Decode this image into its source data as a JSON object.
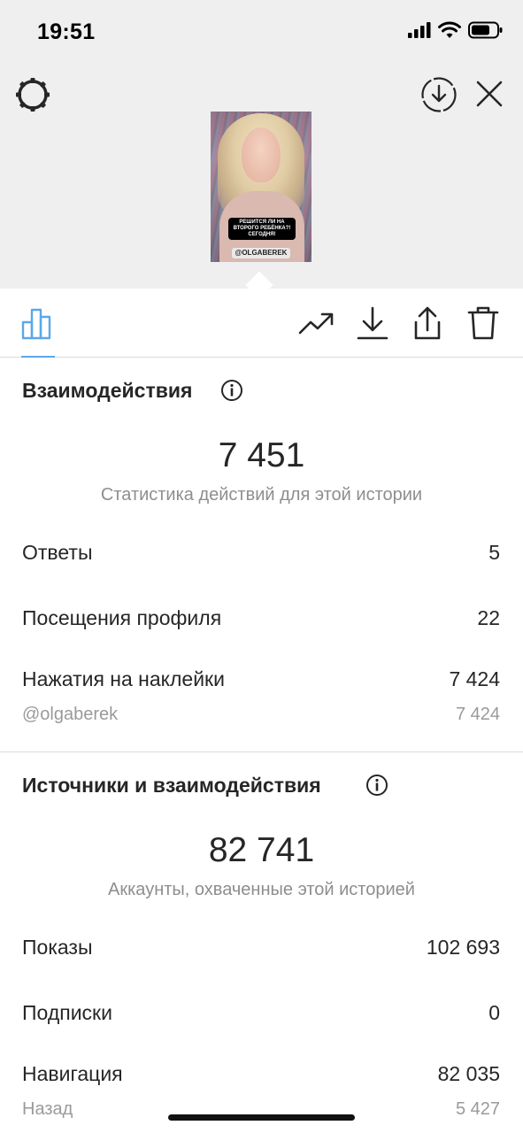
{
  "status_bar": {
    "time": "19:51"
  },
  "story_preview": {
    "sticker_text": "РЕШИТСЯ ЛИ НА ВТОРОГО РЕБЁНКА?! СЕГОДНЯ!",
    "mention_text": "@OLGABEREK"
  },
  "icons": {
    "settings": "gear-icon",
    "download_circle": "download-circle-icon",
    "close": "close-icon",
    "insights_tab": "bar-chart-icon",
    "promote": "trending-up-icon",
    "download": "download-icon",
    "share": "share-icon",
    "delete": "trash-icon",
    "info": "info-icon"
  },
  "colors": {
    "accent": "#5ba8e8",
    "text": "#262626",
    "muted": "#8e8e8e"
  },
  "interactions": {
    "title": "Взаимодействия",
    "total": "7 451",
    "subtitle": "Статистика действий для этой истории",
    "rows": [
      {
        "label": "Ответы",
        "value": "5"
      },
      {
        "label": "Посещения профиля",
        "value": "22"
      },
      {
        "label": "Нажатия на наклейки",
        "value": "7 424"
      }
    ],
    "sub_rows": [
      {
        "label": "@olgaberek",
        "value": "7 424"
      }
    ]
  },
  "discovery": {
    "title": "Источники и взаимодействия",
    "total": "82 741",
    "subtitle": "Аккаунты, охваченные этой историей",
    "rows": [
      {
        "label": "Показы",
        "value": "102 693"
      },
      {
        "label": "Подписки",
        "value": "0"
      },
      {
        "label": "Навигация",
        "value": "82 035"
      }
    ],
    "sub_rows": [
      {
        "label": "Назад",
        "value": "5 427"
      }
    ]
  }
}
